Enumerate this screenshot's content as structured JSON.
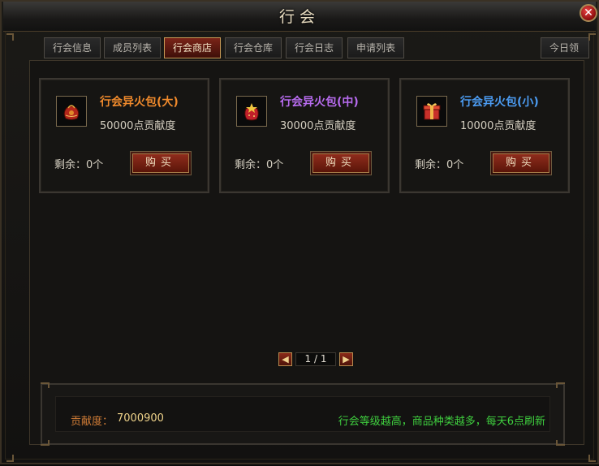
{
  "window": {
    "title": "行会",
    "close_icon": "close-icon"
  },
  "tabs": [
    {
      "label": "行会信息",
      "active": false
    },
    {
      "label": "成员列表",
      "active": false
    },
    {
      "label": "行会商店",
      "active": true
    },
    {
      "label": "行会仓库",
      "active": false
    },
    {
      "label": "行会日志",
      "active": false
    },
    {
      "label": "申请列表",
      "active": false
    },
    {
      "label": "今日领",
      "active": false
    }
  ],
  "items": [
    {
      "name": "行会异火包(大)",
      "name_color": "#f08a2c",
      "cost": "50000点贡献度",
      "remaining": "剩余：0个",
      "buy_label": "购买",
      "icon": "red-pouch-large-icon"
    },
    {
      "name": "行会异火包(中)",
      "name_color": "#b86cf0",
      "cost": "30000点贡献度",
      "remaining": "剩余：0个",
      "buy_label": "购买",
      "icon": "red-pouch-medium-icon"
    },
    {
      "name": "行会异火包(小)",
      "name_color": "#4c9cf2",
      "cost": "10000点贡献度",
      "remaining": "剩余：0个",
      "buy_label": "购买",
      "icon": "gift-box-small-icon"
    }
  ],
  "pager": {
    "page": "1 / 1",
    "prev_icon": "chevron-left-icon",
    "next_icon": "chevron-right-icon"
  },
  "footer": {
    "contribution_label": "贡献度：",
    "contribution_value": "7000900",
    "hint": "行会等级越高，商品种类越多，每天6点刷新"
  }
}
